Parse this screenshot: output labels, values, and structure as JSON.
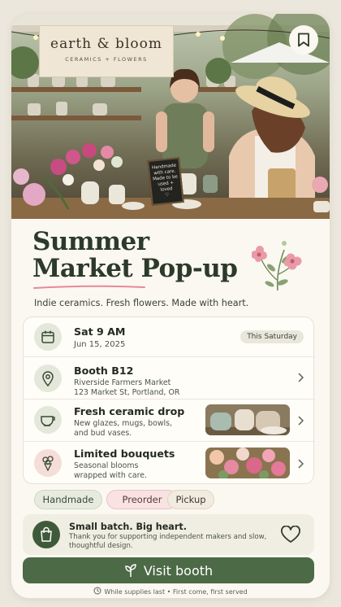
{
  "hero": {
    "sign_title": "earth & bloom",
    "sign_subtitle": "CERAMICS + FLOWERS",
    "chalkboard_lines": [
      "Handmade",
      "with care.",
      "Made to be",
      "used + loved",
      "♡"
    ]
  },
  "title_line1": "Summer",
  "title_line2": "Market Pop-up",
  "tagline": "Indie ceramics. Fresh flowers. Made with heart.",
  "details": [
    {
      "title": "Sat 9 AM",
      "sub": "Jun 15, 2025",
      "badge": "This Saturday",
      "icon": "calendar-icon"
    },
    {
      "title": "Booth B12",
      "sub1": "Riverside Farmers Market",
      "sub2": "123 Market St, Portland, OR",
      "icon": "map-pin-icon"
    },
    {
      "title": "Fresh ceramic drop",
      "sub1": "New glazes, mugs, bowls,",
      "sub2": "and bud vases.",
      "icon": "bowl-icon"
    },
    {
      "title": "Limited bouquets",
      "sub1": "Seasonal blooms",
      "sub2": "wrapped with care.",
      "icon": "bouquet-icon"
    }
  ],
  "chips": [
    "Handmade",
    "Preorder",
    "Pickup"
  ],
  "note": {
    "title": "Small batch. Big heart.",
    "body": "Thank you for supporting independent makers and slow, thoughtful design."
  },
  "cta_label": "Visit booth",
  "footer": "While supplies last • First come, first served",
  "colors": {
    "accent": "#4c6a45",
    "pink": "#e58a98",
    "cream": "#fbf8f1"
  }
}
